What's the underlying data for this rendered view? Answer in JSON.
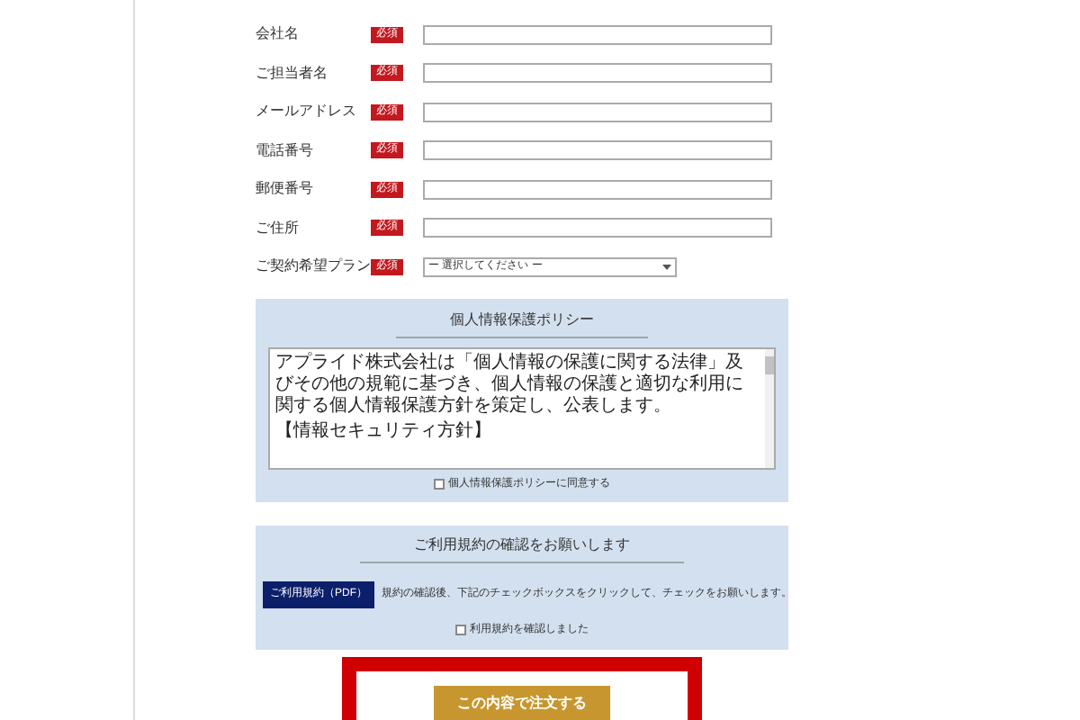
{
  "form": {
    "fields": [
      {
        "label": "会社名",
        "badge": "必須",
        "kind": "text"
      },
      {
        "label": "ご担当者名",
        "badge": "必須",
        "kind": "text"
      },
      {
        "label": "メールアドレス",
        "badge": "必須",
        "kind": "text"
      },
      {
        "label": "電話番号",
        "badge": "必須",
        "kind": "text"
      },
      {
        "label": "郵便番号",
        "badge": "必須",
        "kind": "text"
      },
      {
        "label": "ご住所",
        "badge": "必須",
        "kind": "text"
      },
      {
        "label": "ご契約希望プラン",
        "badge": "必須",
        "kind": "select",
        "value": "ー 選択してください ー"
      }
    ]
  },
  "privacy": {
    "title": "個人情報保護ポリシー",
    "paragraphs": [
      "アプライド株式会社は「個人情報の保護に関する法律」及びその他の規範に基づき、個人情報の保護と適切な利用に関する個人情報保護方針を策定し、公表します。",
      "【情報セキュリティ方針】"
    ],
    "agree": {
      "label": "個人情報保護ポリシーに同意する",
      "checked": false
    }
  },
  "terms": {
    "title": "ご利用規約の確認をお願いします",
    "pdf_button": "ご利用規約（PDF）",
    "note": "規約の確認後、下記のチェックボックスをクリックして、チェックをお願いします。",
    "confirm": {
      "label": "利用規約を確認しました",
      "checked": false
    }
  },
  "submit": "この内容で注文する"
}
